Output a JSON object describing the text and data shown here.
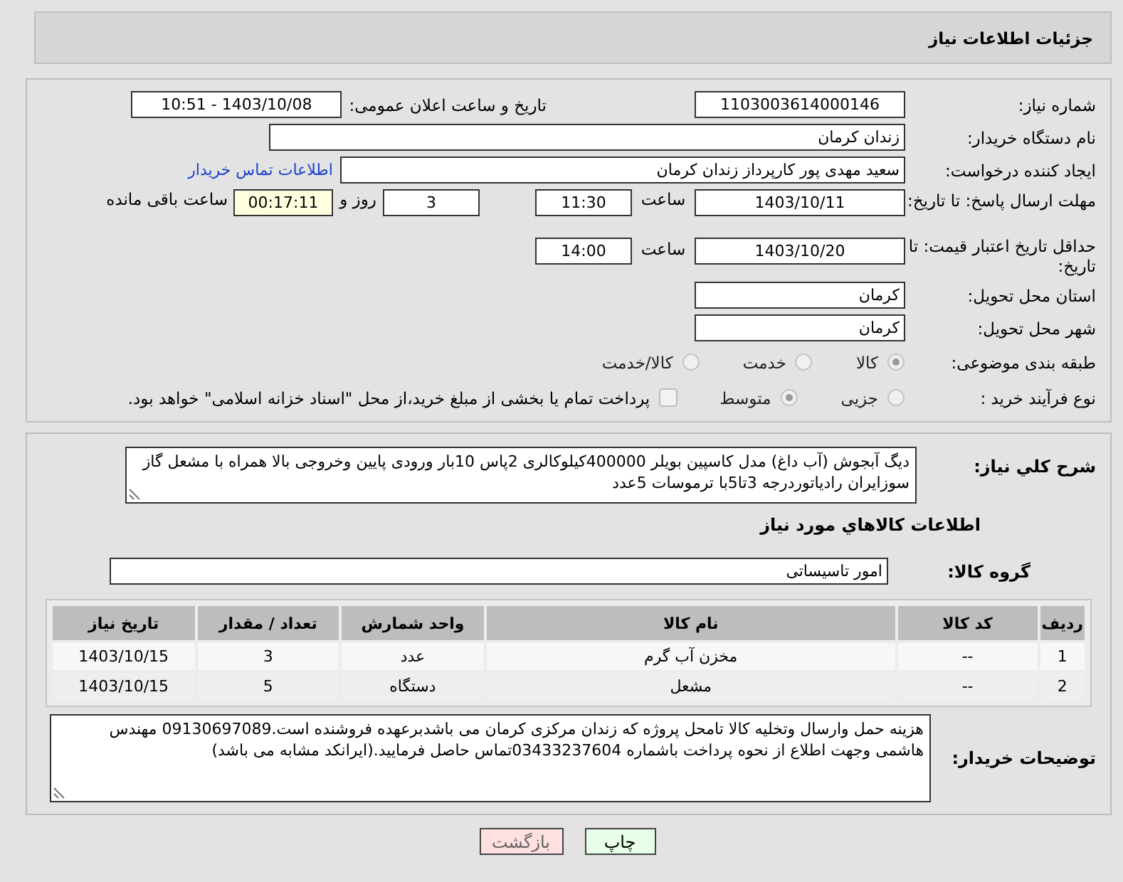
{
  "header": {
    "title": "جزئیات اطلاعات نیاز"
  },
  "form": {
    "need_number": {
      "label": "شماره نیاز:",
      "value": "1103003614000146"
    },
    "announce": {
      "label": "تاریخ و ساعت اعلان عمومی:",
      "value": "1403/10/08 - 10:51"
    },
    "buyer_org": {
      "label": "نام دستگاه خریدار:",
      "value": "زندان کرمان"
    },
    "requester": {
      "label": "ایجاد کننده درخواست:",
      "value": "سعید مهدی پور کارپرداز زندان کرمان",
      "link": "اطلاعات تماس خریدار"
    },
    "response_deadline": {
      "label": "مهلت ارسال پاسخ: تا تاریخ:",
      "date": "1403/10/11",
      "time_label": "ساعت",
      "time": "11:30",
      "days": "3",
      "days_label": "روز و",
      "remaining": "00:17:11",
      "remaining_label": "ساعت باقی مانده"
    },
    "price_validity": {
      "label": "حداقل تاریخ اعتبار قیمت: تا تاریخ:",
      "date": "1403/10/20",
      "time_label": "ساعت",
      "time": "14:00"
    },
    "province": {
      "label": "استان محل تحویل:",
      "value": "کرمان"
    },
    "city": {
      "label": "شهر محل تحویل:",
      "value": "کرمان"
    },
    "category": {
      "label": "طبقه بندی موضوعی:",
      "options": [
        {
          "label": "کالا",
          "selected": true,
          "disabled": true
        },
        {
          "label": "خدمت",
          "selected": false,
          "disabled": true
        },
        {
          "label": "کالا/خدمت",
          "selected": false,
          "disabled": true
        }
      ]
    },
    "purchase_type": {
      "label": "نوع فرآیند خرید :",
      "options": [
        {
          "label": "جزیی",
          "selected": false,
          "disabled": true
        },
        {
          "label": "متوسط",
          "selected": true,
          "disabled": true
        }
      ],
      "treasury": {
        "label": "پرداخت تمام یا بخشی از مبلغ خرید،از محل \"اسناد خزانه اسلامی\" خواهد بود.",
        "checked": false
      }
    }
  },
  "description": {
    "label": "شرح کلي نياز:",
    "value": "دیگ آبجوش (آب داغ) مدل کاسپین بویلر 400000کیلوکالری 2پاس 10بار ورودی پایین وخروجی بالا همراه با مشعل گاز سوزایران رادیاتوردرجه 3تا5با ترموسات 5عدد"
  },
  "items_title": "اطلاعات کالاهاي مورد نياز",
  "goods_group": {
    "label": "گروه کالا:",
    "value": "امور تاسیساتی"
  },
  "table": {
    "columns": [
      "ردیف",
      "کد کالا",
      "نام کالا",
      "واحد شمارش",
      "تعداد / مقدار",
      "تاریخ نیاز"
    ],
    "rows": [
      [
        "1",
        "--",
        "مخزن آب گرم",
        "عدد",
        "3",
        "1403/10/15"
      ],
      [
        "2",
        "--",
        "مشعل",
        "دستگاه",
        "5",
        "1403/10/15"
      ]
    ]
  },
  "buyer_notes": {
    "label": "توضیحات خریدار:",
    "value": "هزینه حمل وارسال وتخلیه کالا تامحل پروژه که زندان مرکزی کرمان می باشدبرعهده فروشنده است.09130697089 مهندس هاشمی  وجهت اطلاع از نحوه پرداخت باشماره 03433237604تماس حاصل فرمایید.(ایرانکد مشابه می باشد)"
  },
  "buttons": [
    {
      "label": "چاپ",
      "kind": "print"
    },
    {
      "label": "بازگشت",
      "kind": "back"
    }
  ]
}
